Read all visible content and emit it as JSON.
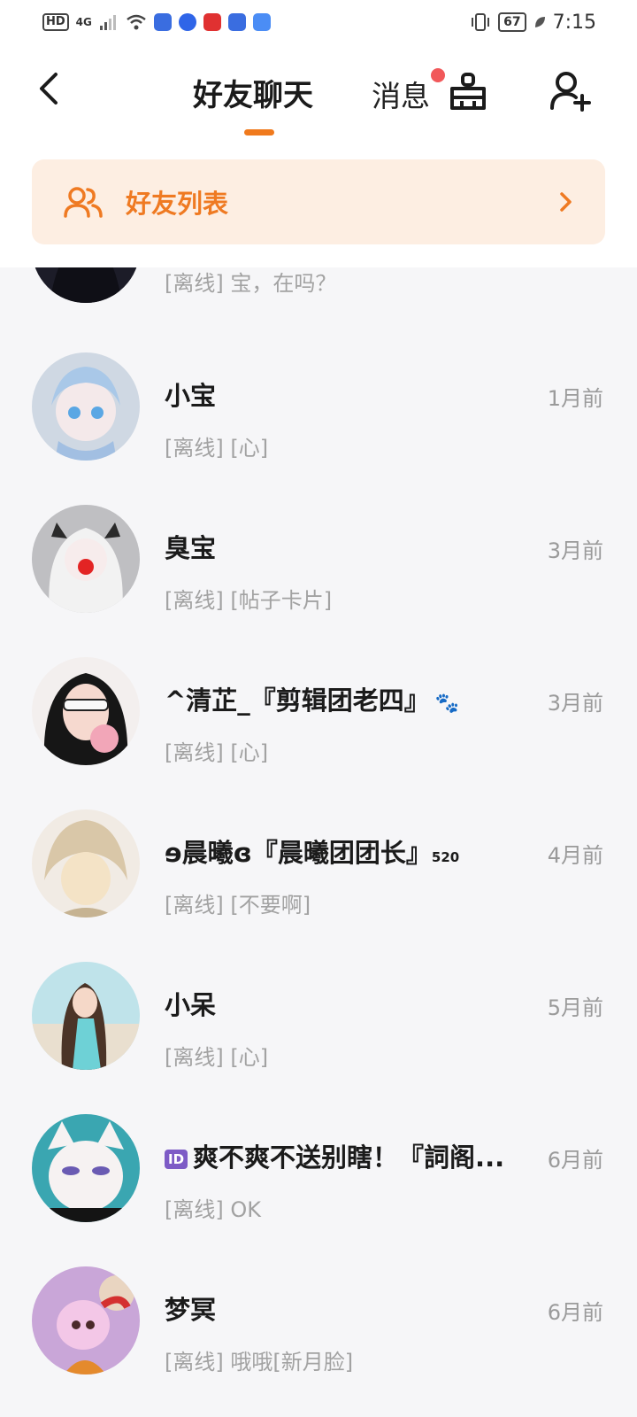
{
  "status_bar": {
    "hd": "HD",
    "signal": "4G",
    "battery": "67",
    "time": "7:15"
  },
  "header": {
    "tab_friends_chat": "好友聊天",
    "tab_messages": "消息",
    "friends_list_label": "好友列表",
    "accent_color": "#f07a1d"
  },
  "conversations": [
    {
      "name": "",
      "preview": "[离线] 宝，在吗？",
      "time": ""
    },
    {
      "name": "小宝",
      "preview": "[离线] [心]",
      "time": "1月前"
    },
    {
      "name": "臭宝",
      "preview": "[离线] [帖子卡片]",
      "time": "3月前"
    },
    {
      "name": "^清芷_『剪辑团老四』",
      "preview": "[离线] [心]",
      "time": "3月前"
    },
    {
      "name": "ɘ晨曦ɞ『晨曦团团长』",
      "name_suffix": "520",
      "preview": "[离线] [不要啊]",
      "time": "4月前"
    },
    {
      "name": "小呆",
      "preview": "[离线] [心]",
      "time": "5月前"
    },
    {
      "name": "爽不爽不送别瞎！『詞阁...",
      "badge": "ID",
      "preview": "[离线] OK",
      "time": "6月前"
    },
    {
      "name": "梦冥",
      "preview": "[离线] 哦哦[新月脸]",
      "time": "6月前"
    }
  ]
}
